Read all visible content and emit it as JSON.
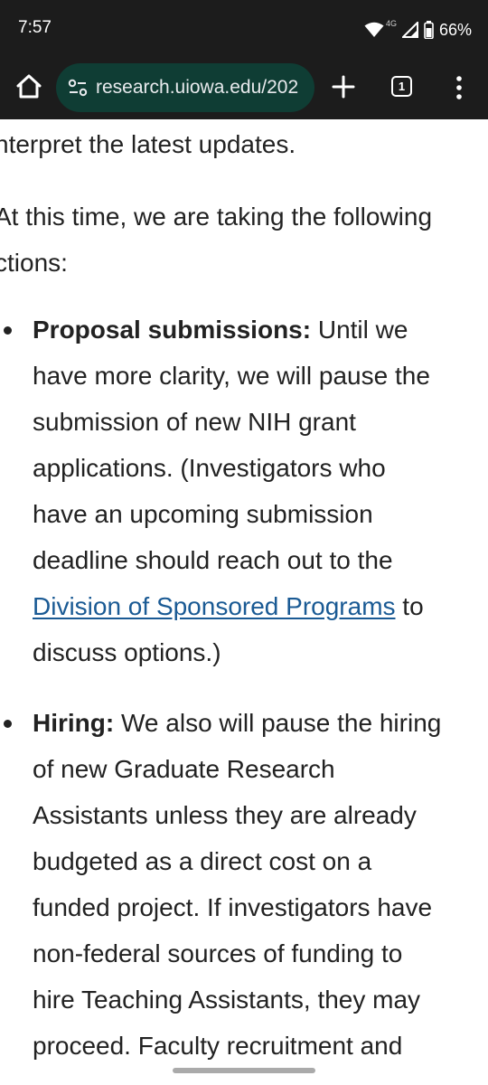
{
  "status_bar": {
    "time": "7:57",
    "network": "4G",
    "battery": "66%"
  },
  "browser": {
    "url": "research.uiowa.edu/202",
    "tab_count": "1"
  },
  "article": {
    "line_top": "nterpret the latest updates.",
    "para2_line1": "At this time, we are taking the following",
    "para2_line2": "ctions:",
    "items": [
      {
        "heading": "Proposal submissions:",
        "line1_rest": " Until we",
        "line2": "have more clarity, we will pause the",
        "line3": "submission of new NIH grant",
        "line4": "applications. (Investigators who",
        "line5": "have an upcoming submission",
        "line6": "deadline should reach out to the",
        "link": "Division of Sponsored Programs",
        "line7_rest": " to",
        "line8": "discuss options.)"
      },
      {
        "heading": "Hiring:",
        "line1_rest": " We also will pause the hiring",
        "line2": "of new Graduate Research",
        "line3": "Assistants unless they are already",
        "line4": "budgeted as a direct cost on a",
        "line5": "funded project. If investigators have",
        "line6": "non-federal sources of funding to",
        "line7": "hire Teaching Assistants, they may",
        "line8": "proceed. Faculty recruitment and"
      }
    ]
  },
  "colors": {
    "chrome_bg": "#1c1c1c",
    "url_bar_bg": "#0f3d34",
    "link": "#1a5a94",
    "text": "#222222"
  }
}
